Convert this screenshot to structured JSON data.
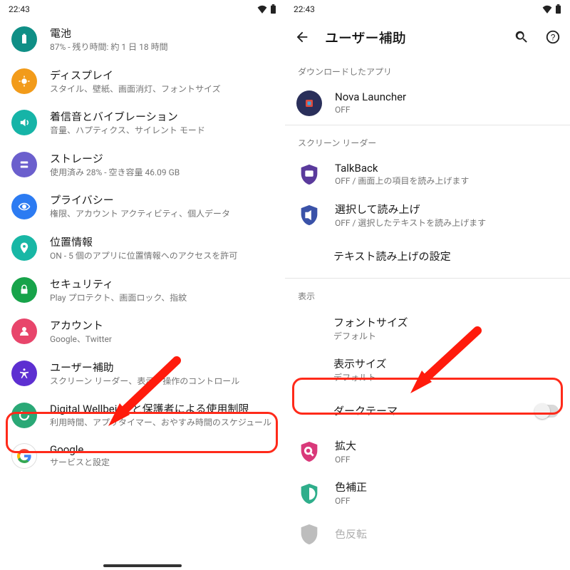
{
  "status": {
    "time": "22:43"
  },
  "left": {
    "items": [
      {
        "title": "電池",
        "sub": "87% - 残り時間: 約 1 日 18 時間",
        "color": "#0f8f86",
        "icon": "battery"
      },
      {
        "title": "ディスプレイ",
        "sub": "スタイル、壁紙、画面消灯、フォントサイズ",
        "color": "#f29b1a",
        "icon": "display"
      },
      {
        "title": "着信音とバイブレーション",
        "sub": "音量、ハプティクス、サイレント モード",
        "color": "#16b4a7",
        "icon": "sound"
      },
      {
        "title": "ストレージ",
        "sub": "使用済み 28% - 空き容量 46.09 GB",
        "color": "#6b5fcd",
        "icon": "storage"
      },
      {
        "title": "プライバシー",
        "sub": "権限、アカウント アクティビティ、個人データ",
        "color": "#2c7bf2",
        "icon": "privacy"
      },
      {
        "title": "位置情報",
        "sub": "ON - 5 個のアプリに位置情報へのアクセスを許可",
        "color": "#18b7a5",
        "icon": "location"
      },
      {
        "title": "セキュリティ",
        "sub": "Play プロテクト、画面ロック、指紋",
        "color": "#17a34a",
        "icon": "security"
      },
      {
        "title": "アカウント",
        "sub": "Google、Twitter",
        "color": "#e8456b",
        "icon": "account"
      },
      {
        "title": "ユーザー補助",
        "sub": "スクリーン リーダー、表示、操作のコントロール",
        "color": "#5d2fd1",
        "icon": "a11y"
      },
      {
        "title": "Digital Wellbeing と保護者による使用制限",
        "sub": "利用時間、アプリタイマー、おやすみ時間のスケジュール",
        "color": "#2aa876",
        "icon": "wellbeing"
      },
      {
        "title": "Google",
        "sub": "サービスと設定",
        "color": "#ffffff",
        "icon": "google"
      }
    ]
  },
  "right": {
    "pageTitle": "ユーザー補助",
    "sections": {
      "downloaded": "ダウンロードしたアプリ",
      "screenreader": "スクリーン リーダー",
      "display": "表示"
    },
    "nova": {
      "title": "Nova Launcher",
      "sub": "OFF"
    },
    "talkback": {
      "title": "TalkBack",
      "sub": "OFF / 画面上の項目を読み上げます"
    },
    "select": {
      "title": "選択して読み上げ",
      "sub": "OFF / 選択したテキストを読み上げます"
    },
    "tts": {
      "title": "テキスト読み上げの設定"
    },
    "fontsize": {
      "title": "フォントサイズ",
      "sub": "デフォルト"
    },
    "dispsize": {
      "title": "表示サイズ",
      "sub": "デフォルト"
    },
    "darktheme": {
      "title": "ダークテーマ"
    },
    "magnify": {
      "title": "拡大",
      "sub": "OFF"
    },
    "colorcorr": {
      "title": "色補正",
      "sub": "OFF"
    },
    "colorinv": {
      "title": "色反転"
    }
  }
}
